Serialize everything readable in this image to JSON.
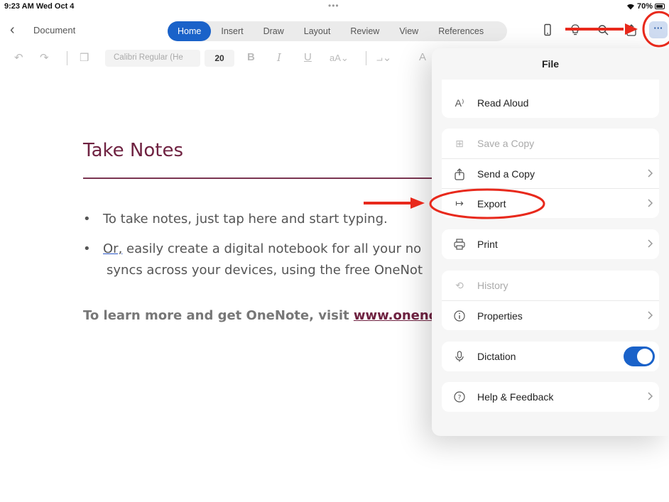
{
  "status_bar": {
    "time": "9:23 AM  Wed Oct 4",
    "battery": "70%"
  },
  "header": {
    "document_name": "Document",
    "tabs": [
      {
        "label": "Home",
        "active": true
      },
      {
        "label": "Insert",
        "active": false
      },
      {
        "label": "Draw",
        "active": false
      },
      {
        "label": "Layout",
        "active": false
      },
      {
        "label": "Review",
        "active": false
      },
      {
        "label": "View",
        "active": false
      },
      {
        "label": "References",
        "active": false
      }
    ],
    "more_label": "···"
  },
  "format_bar": {
    "font_name": "Calibri Regular (He",
    "font_size": "20"
  },
  "document": {
    "title": "Take Notes",
    "bullet1": "To take notes, just tap here and start typing.",
    "bullet2_link": "Or,",
    "bullet2_rest": " easily create a digital notebook for all your no",
    "bullet2_line2": "syncs across your devices, using the free OneNot",
    "learn_prefix": "To learn more and get OneNote, visit ",
    "learn_url": "www.onenote"
  },
  "file_panel": {
    "title": "File",
    "read_aloud": "Read Aloud",
    "save_copy": "Save a Copy",
    "send_copy": "Send a Copy",
    "export": "Export",
    "print": "Print",
    "history": "History",
    "properties": "Properties",
    "dictation": "Dictation",
    "dictation_on": true,
    "help": "Help & Feedback"
  },
  "colors": {
    "accent": "#1a62c9",
    "title": "#6f2241",
    "annotation": "#e8291c"
  }
}
